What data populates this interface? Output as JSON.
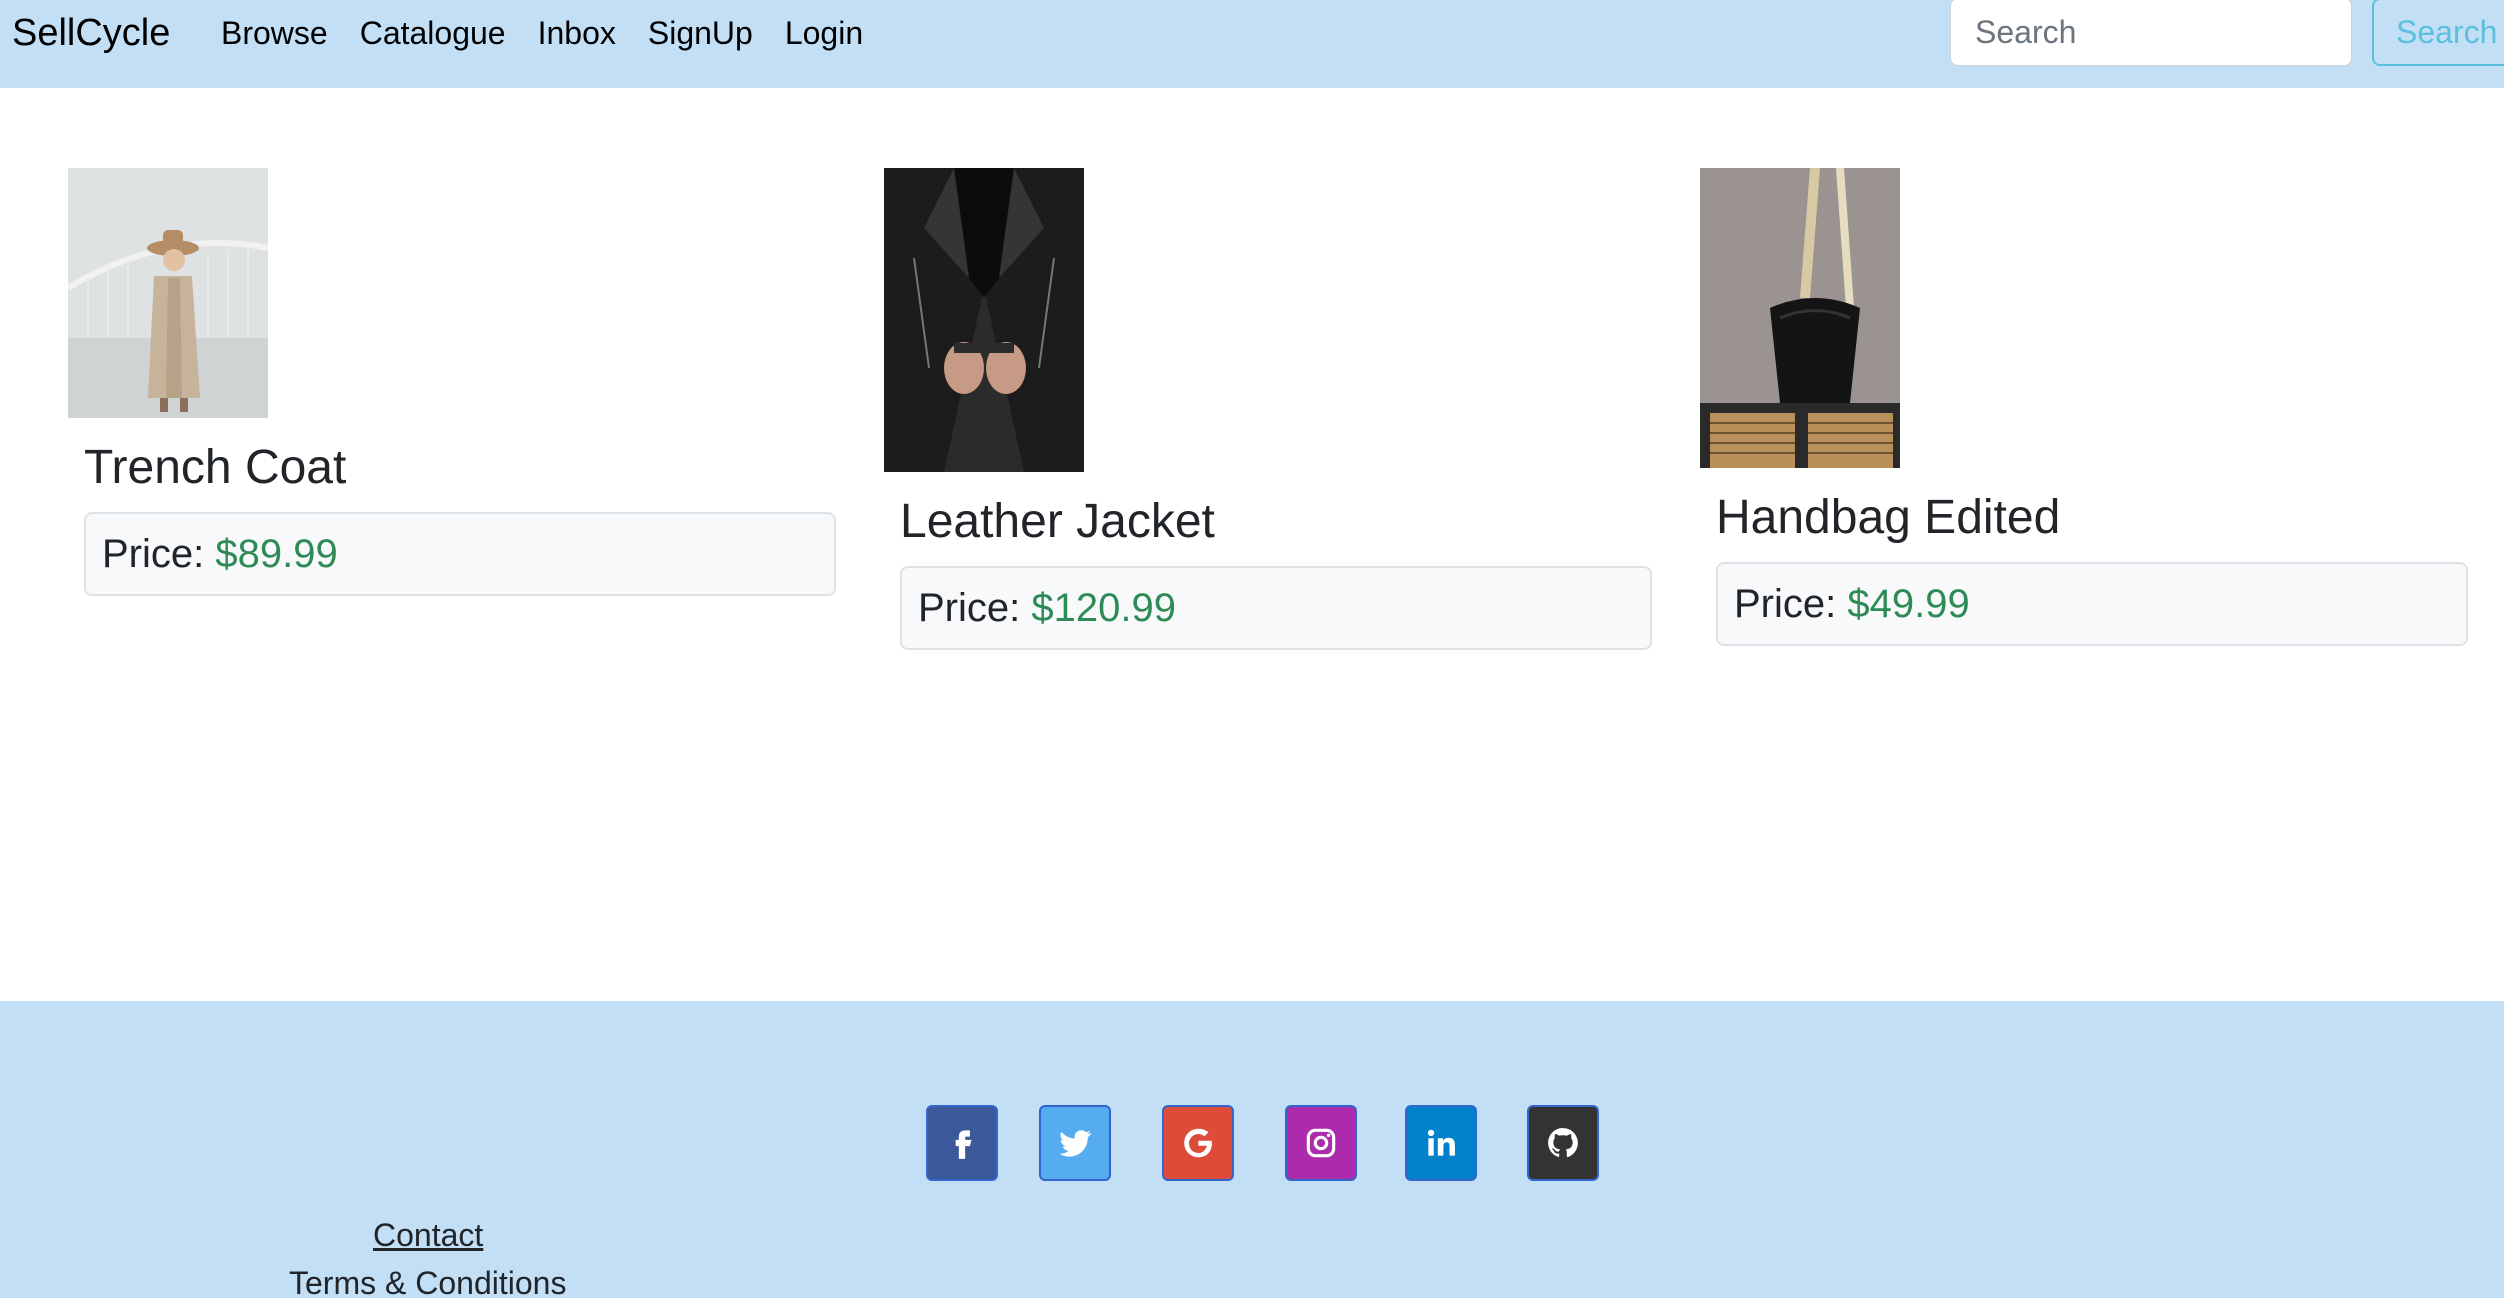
{
  "navbar": {
    "brand": "SellCycle",
    "links": [
      "Browse",
      "Catalogue",
      "Inbox",
      "SignUp",
      "Login"
    ],
    "search": {
      "placeholder": "Search",
      "button_label": "Search"
    }
  },
  "products": [
    {
      "name": "Trench Coat",
      "price_label": "Price:",
      "price": "$89.99",
      "image": "woman-in-trench-coat-photo"
    },
    {
      "name": "Leather Jacket",
      "price_label": "Price:",
      "price": "$120.99",
      "image": "person-in-leather-jacket-photo"
    },
    {
      "name": "Handbag Edited",
      "price_label": "Price:",
      "price": "$49.99",
      "image": "black-handbag-photo"
    }
  ],
  "footer": {
    "socials": [
      {
        "name": "facebook-icon",
        "color": "#3b5998"
      },
      {
        "name": "twitter-icon",
        "color": "#55acee"
      },
      {
        "name": "google-icon",
        "color": "#dd4b39"
      },
      {
        "name": "instagram-icon",
        "color": "#ac2bac"
      },
      {
        "name": "linkedin-icon",
        "color": "#0082ca"
      },
      {
        "name": "github-icon",
        "color": "#333333"
      }
    ],
    "contact": "Contact",
    "terms": "Terms & Conditions"
  },
  "colors": {
    "navbar_bg": "#c3dff6",
    "price_green": "#2e8b57",
    "search_button": "#5bc0de"
  }
}
